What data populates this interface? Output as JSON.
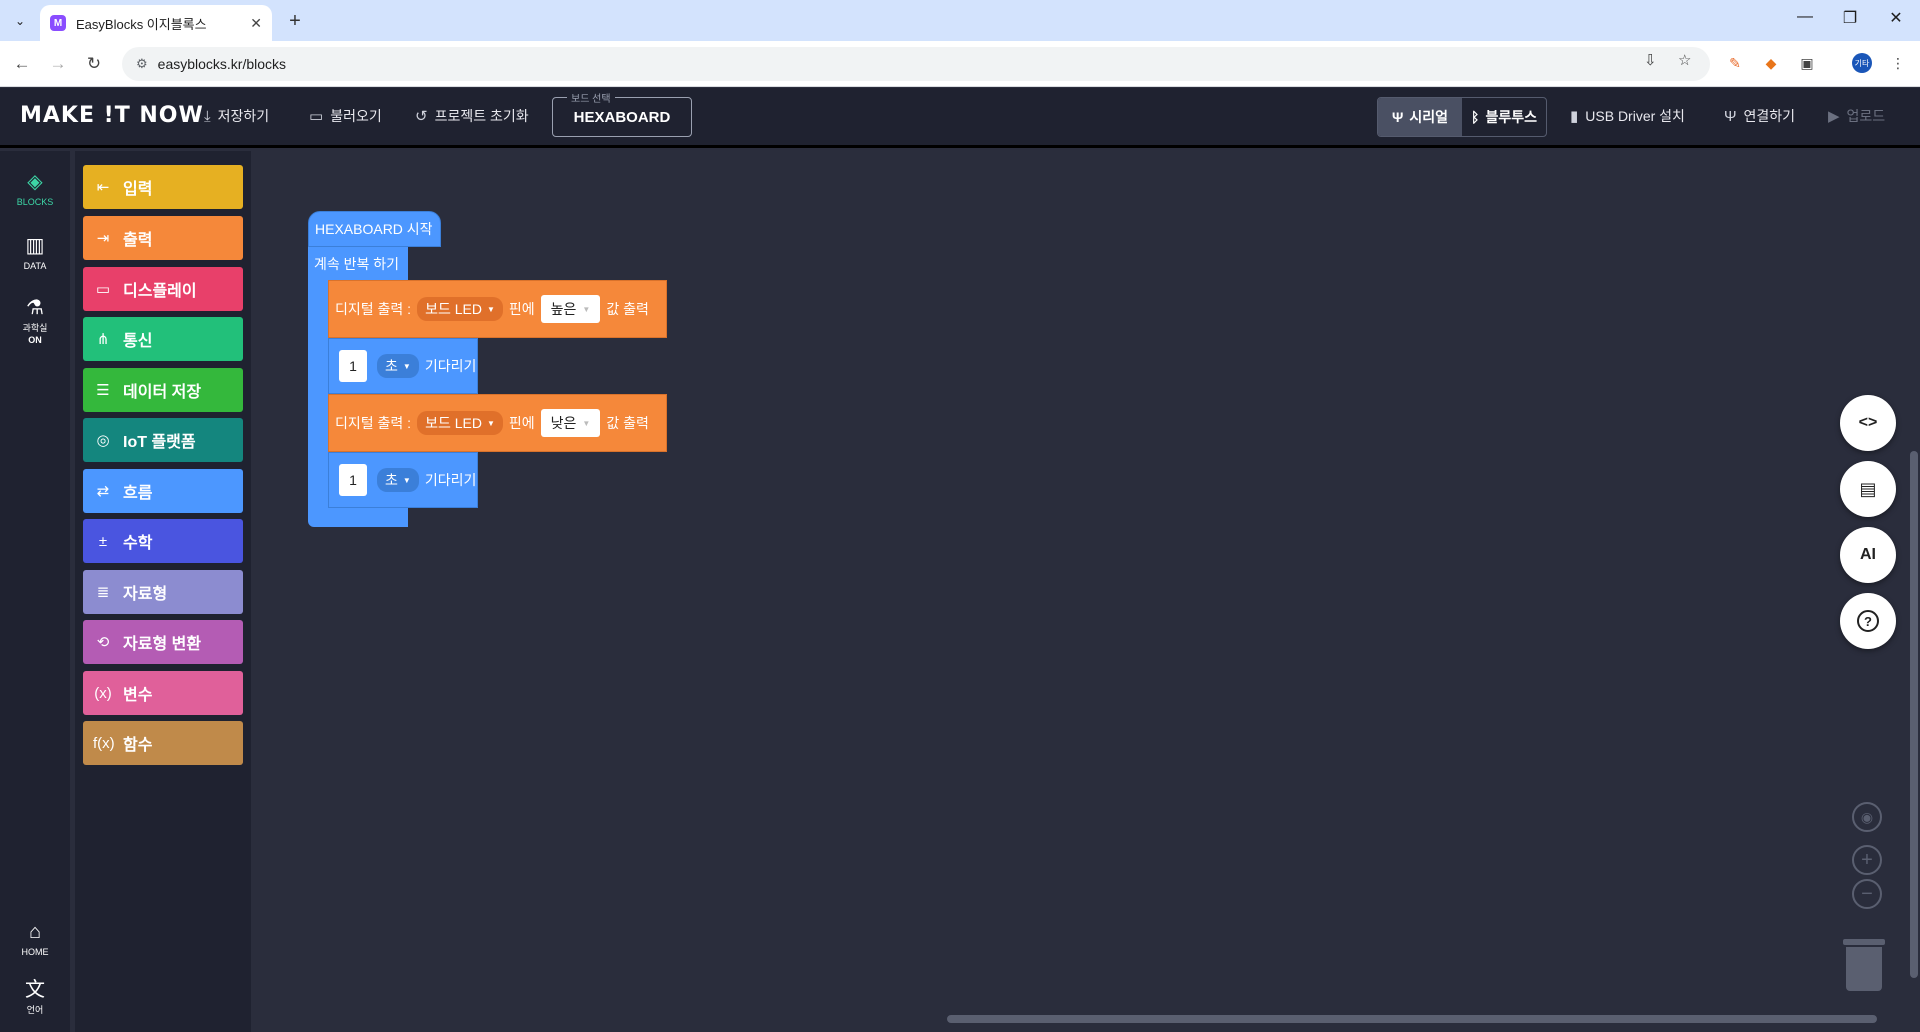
{
  "browser": {
    "tab_title": "EasyBlocks 이지블록스",
    "favicon": "M",
    "url": "easyblocks.kr/blocks",
    "profile_label": "기타"
  },
  "header": {
    "logo": "MAKE !T NOW",
    "save": "저장하기",
    "load": "불러오기",
    "reset": "프로젝트 초기화",
    "board_legend": "보드 선택",
    "board_value": "HEXABOARD",
    "serial": "시리얼",
    "bluetooth": "블루투스",
    "usb_driver": "USB Driver 설치",
    "connect": "연결하기",
    "upload": "업로드"
  },
  "leftnav": {
    "blocks": "BLOCKS",
    "data": "DATA",
    "science_1": "과학실",
    "science_2": "ON",
    "home": "HOME",
    "language": "언어"
  },
  "categories": [
    {
      "label": "입력",
      "color": "#e6b022",
      "icon": "input-icon"
    },
    {
      "label": "출력",
      "color": "#f5883a",
      "icon": "output-icon"
    },
    {
      "label": "디스플레이",
      "color": "#e8406a",
      "icon": "display-icon"
    },
    {
      "label": "통신",
      "color": "#22c07a",
      "icon": "communication-icon"
    },
    {
      "label": "데이터 저장",
      "color": "#34b83c",
      "icon": "storage-icon"
    },
    {
      "label": "IoT 플랫폼",
      "color": "#14867e",
      "icon": "iot-icon"
    },
    {
      "label": "흐름",
      "color": "#4c97ff",
      "icon": "flow-icon"
    },
    {
      "label": "수학",
      "color": "#4a55e0",
      "icon": "math-icon"
    },
    {
      "label": "자료형",
      "color": "#8c8cd0",
      "icon": "datatype-icon"
    },
    {
      "label": "자료형 변환",
      "color": "#b45cb4",
      "icon": "convert-icon"
    },
    {
      "label": "변수",
      "color": "#e0609a",
      "icon": "variable-icon"
    },
    {
      "label": "함수",
      "color": "#c08a4a",
      "icon": "function-icon"
    }
  ],
  "blocks": {
    "start": "HEXABOARD 시작",
    "loop": "계속 반복 하기",
    "out1": {
      "prefix": "디지털 출력 :",
      "pin": "보드 LED",
      "mid": "핀에",
      "value": "높은",
      "suffix": "값 출력"
    },
    "wait1": {
      "num": "1",
      "unit": "초",
      "suffix": "기다리기"
    },
    "out2": {
      "prefix": "디지털 출력 :",
      "pin": "보드 LED",
      "mid": "핀에",
      "value": "낮은",
      "suffix": "값 출력"
    },
    "wait2": {
      "num": "1",
      "unit": "초",
      "suffix": "기다리기"
    }
  },
  "fabs": {
    "code": "<>",
    "ai": "AI",
    "help": "?"
  }
}
